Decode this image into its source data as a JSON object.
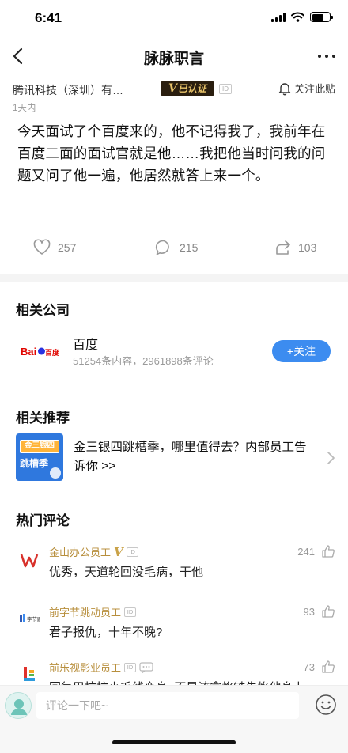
{
  "status_bar": {
    "time": "6:41"
  },
  "nav": {
    "title": "脉脉职言",
    "back_icon": "chevron-left-icon",
    "more_icon": "more-horizontal-icon"
  },
  "post": {
    "author": "腾讯科技（深圳）有…",
    "verified_label": "已认证",
    "verified_v": "V",
    "id_tag": "ID",
    "follow_label": "关注此贴",
    "time": "1天内",
    "content": "今天面试了个百度来的，他不记得我了，我前年在百度二面的面试官就是他……我把他当时问我的问题又问了他一遍，他居然就答上来一个。",
    "likes": "257",
    "comments": "215",
    "shares": "103"
  },
  "related_company": {
    "title": "相关公司",
    "name": "百度",
    "stats": "51254条内容，2961898条评论",
    "follow_label": "+关注",
    "logo_text_en": "Bai",
    "logo_text_cn": "百度"
  },
  "recommend": {
    "title": "相关推荐",
    "thumb_line1": "金三银四",
    "thumb_line2": "跳槽季",
    "text": "金三银四跳槽季，哪里值得去？内部员工告诉你 >>"
  },
  "hot_comments": {
    "title": "热门评论",
    "items": [
      {
        "author": "金山办公员工",
        "has_v": true,
        "v": "V",
        "id": "ID",
        "text": "优秀，天道轮回没毛病，干他",
        "likes": "241",
        "avatar": "wps-logo-icon"
      },
      {
        "author": "前字节跳动员工",
        "has_v": false,
        "v": "",
        "id": "ID",
        "text": "君子报仇，十年不晚?",
        "likes": "93",
        "avatar": "bytedance-logo-icon"
      },
      {
        "author": "前乐视影业员工",
        "has_v": false,
        "v": "",
        "id": "ID",
        "text": "回复巴拉拉小毛线变身: 不是该拿烙铁先烙他身上，",
        "likes": "73",
        "avatar": "letv-logo-icon"
      }
    ]
  },
  "bottom": {
    "placeholder": "评论一下吧~"
  },
  "colors": {
    "accent": "#3c8cf0",
    "gold": "#b88f3d",
    "badge_bg": "#2a1e0f"
  }
}
